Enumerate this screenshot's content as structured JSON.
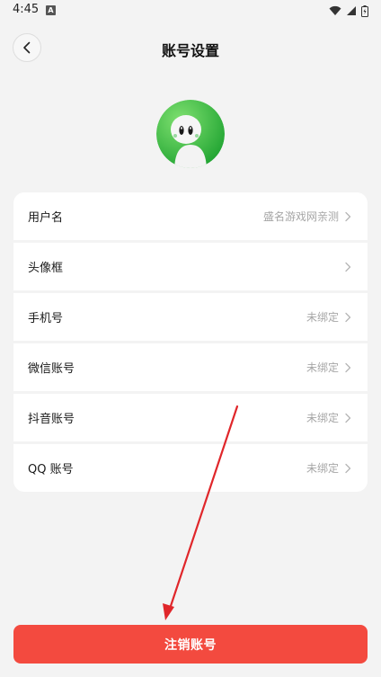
{
  "status_bar": {
    "time": "4:45",
    "notification_glyph": "A",
    "icons": [
      "wifi-icon",
      "signal-icon",
      "battery-icon"
    ]
  },
  "header": {
    "title": "账号设置",
    "back_icon": "chevron-left-icon"
  },
  "avatar": {
    "icon": "mascot-avatar",
    "colors": {
      "bg_light": "#6fdc6a",
      "bg_dark": "#2aa83a"
    }
  },
  "settings": {
    "items": [
      {
        "label": "用户名",
        "value": "盛名游戏网亲测"
      },
      {
        "label": "头像框",
        "value": ""
      },
      {
        "label": "手机号",
        "value": "未绑定"
      },
      {
        "label": "微信账号",
        "value": "未绑定"
      },
      {
        "label": "抖音账号",
        "value": "未绑定"
      },
      {
        "label": "QQ 账号",
        "value": "未绑定"
      }
    ]
  },
  "footer": {
    "cancel_account_label": "注销账号",
    "button_color": "#f34a3f"
  },
  "annotation": {
    "arrow_color": "#e0262a"
  }
}
